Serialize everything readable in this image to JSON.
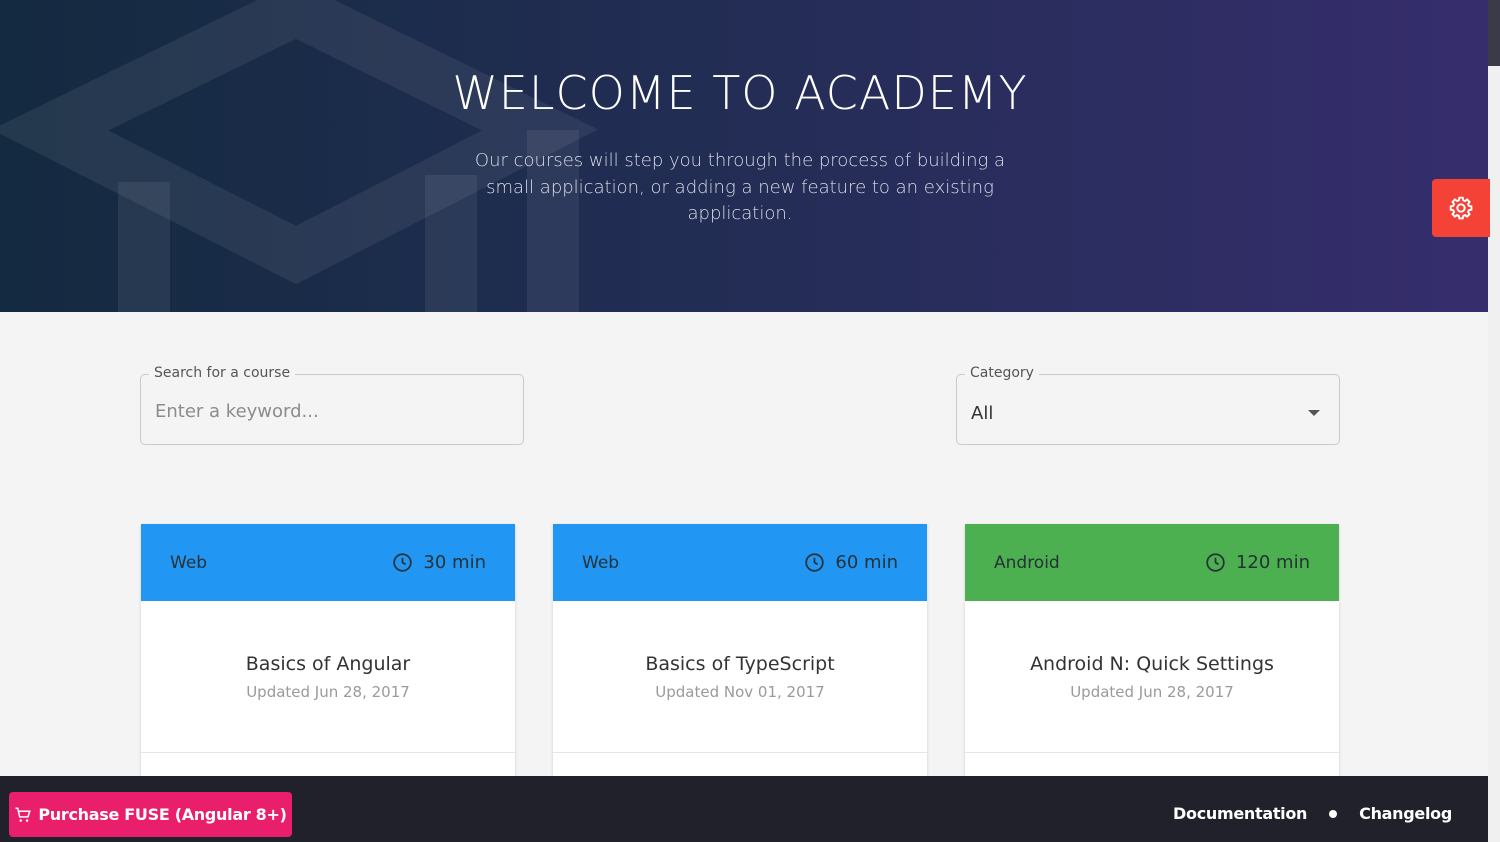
{
  "hero": {
    "title": "WELCOME TO ACADEMY",
    "subtitle": "Our courses will step you through the process of building a small application, or adding a new feature to an existing application."
  },
  "search": {
    "label": "Search for a course",
    "placeholder": "Enter a keyword..."
  },
  "category": {
    "label": "Category",
    "selected": "All"
  },
  "courses": [
    {
      "category": "Web",
      "duration": "30 min",
      "title": "Basics of Angular",
      "updated": "Updated Jun 28, 2017",
      "color": "#2196f3"
    },
    {
      "category": "Web",
      "duration": "60 min",
      "title": "Basics of TypeScript",
      "updated": "Updated Nov 01, 2017",
      "color": "#2196f3"
    },
    {
      "category": "Android",
      "duration": "120 min",
      "title": "Android N: Quick Settings",
      "updated": "Updated Jun 28, 2017",
      "color": "#4caf50"
    }
  ],
  "footer": {
    "purchase_label": "Purchase FUSE (Angular 8+)",
    "documentation": "Documentation",
    "changelog": "Changelog"
  },
  "colors": {
    "accent": "#ea1f6b",
    "settings": "#f44336",
    "footer_bg": "#21212b"
  },
  "icons": {
    "settings": "gear-icon",
    "duration": "clock-icon",
    "purchase": "shopping-cart-icon",
    "category_dropdown": "caret-down-icon",
    "hero_background": "graduation-cap-icon"
  }
}
